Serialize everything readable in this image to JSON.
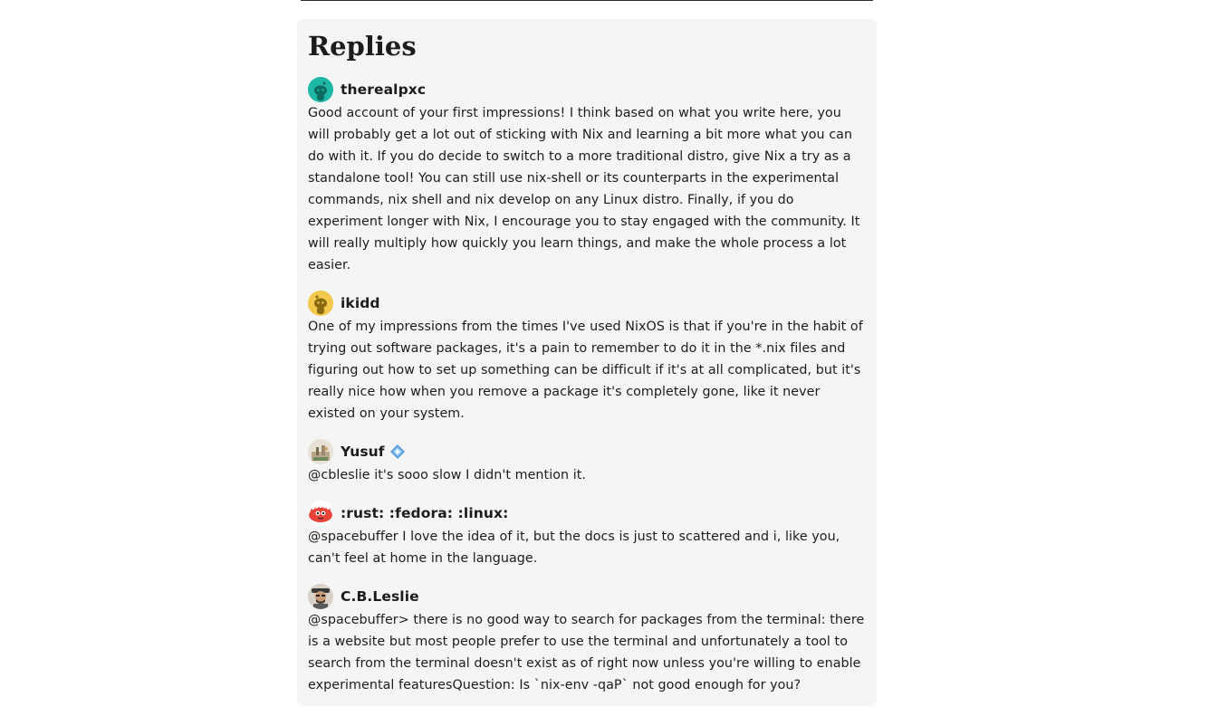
{
  "section": {
    "title": "Replies"
  },
  "replies": [
    {
      "username": "therealpxc",
      "avatar_icon": "reddit-snoo-teal-avatar",
      "avatar_color": "#1fb8a6",
      "body": "Good account of your first impressions! I think based on what you write here, you will probably get a lot out of sticking with Nix and learning a bit more what you can do with it. If you do decide to switch to a more traditional distro, give Nix a try as a standalone tool! You can still use nix-shell or its counterparts in the experimental commands, nix shell and nix develop on any Linux distro. Finally, if you do experiment longer with Nix, I encourage you to stay engaged with the community. It will really multiply how quickly you learn things, and make the whole process a lot easier."
    },
    {
      "username": "ikidd",
      "avatar_icon": "reddit-snoo-yellow-avatar",
      "avatar_color": "#f2c94c",
      "body": "One of my impressions from the times I've used NixOS is that if you're in the habit of trying out software packages, it's a pain to remember to do it in the *.nix files and figuring out how to set up something can be difficult if it's at all complicated, but it's really nice how when you remove a package it's completely gone, like it never existed on your system."
    },
    {
      "username": "Yusuf",
      "avatar_icon": "photo-avatar",
      "avatar_color": "#c9b89a",
      "badge_icon": "blue-diamond-badge-icon",
      "body": "@cbleslie it's sooo slow I didn't mention it."
    },
    {
      "username": ":rust: :fedora: :linux:",
      "avatar_icon": "ferris-crab-avatar",
      "avatar_color": "#e8443a",
      "body": "@spacebuffer I love the idea of it, but the docs is just to scattered and i, like you, can't feel at home in the language."
    },
    {
      "username": "C.B.Leslie",
      "avatar_icon": "photo-avatar",
      "avatar_color": "#8a7a6a",
      "body": "@spacebuffer> there is no good way to search for packages from the terminal: there is a website but most people prefer to use the terminal and unfortunately a tool to search from the terminal doesn't exist as of right now unless you're willing to enable experimental featuresQuestion: Is `nix-env -qaP` not good enough for you?"
    }
  ]
}
